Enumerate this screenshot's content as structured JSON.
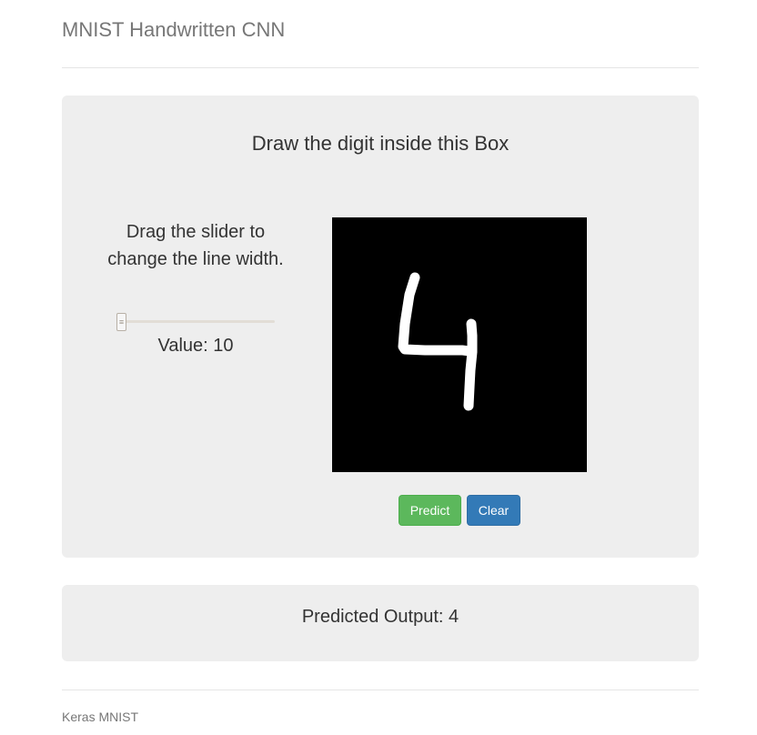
{
  "header": {
    "title": "MNIST Handwritten CNN"
  },
  "drawing_panel": {
    "title": "Draw the digit inside this Box",
    "canvas_background": "#000000",
    "stroke_color": "#ffffff",
    "drawn_digit": "4"
  },
  "slider": {
    "instructions": "Drag the slider to change the line width.",
    "value_text": "Value: 10",
    "value": 10
  },
  "buttons": {
    "predict_label": "Predict",
    "predict_color": "#5cb85c",
    "clear_label": "Clear",
    "clear_color": "#337ab7"
  },
  "output": {
    "text": "Predicted Output: 4"
  },
  "footer": {
    "text": "Keras MNIST"
  }
}
